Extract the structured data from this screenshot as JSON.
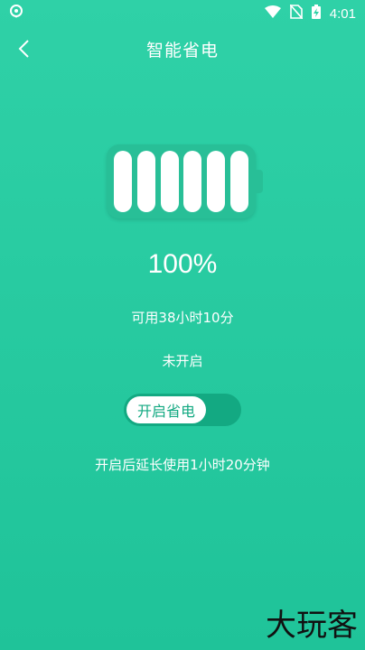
{
  "status_bar": {
    "time": "4:01",
    "icons": [
      "location-pin-icon",
      "wifi-icon",
      "no-sim-icon",
      "battery-charging-icon"
    ]
  },
  "header": {
    "title": "智能省电",
    "back_icon": "chevron-left-icon"
  },
  "battery": {
    "level_percent": 100,
    "cells": 6,
    "colors": {
      "body": "#28bf97",
      "cell": "#ffffff",
      "background": "#2fd1a7"
    }
  },
  "main": {
    "percent_label": "100%",
    "available_label": "可用38小时10分",
    "state_label": "未开启",
    "toggle_label": "开启省电",
    "extend_label": "开启后延长使用1小时20分钟"
  },
  "watermark": "大玩客"
}
